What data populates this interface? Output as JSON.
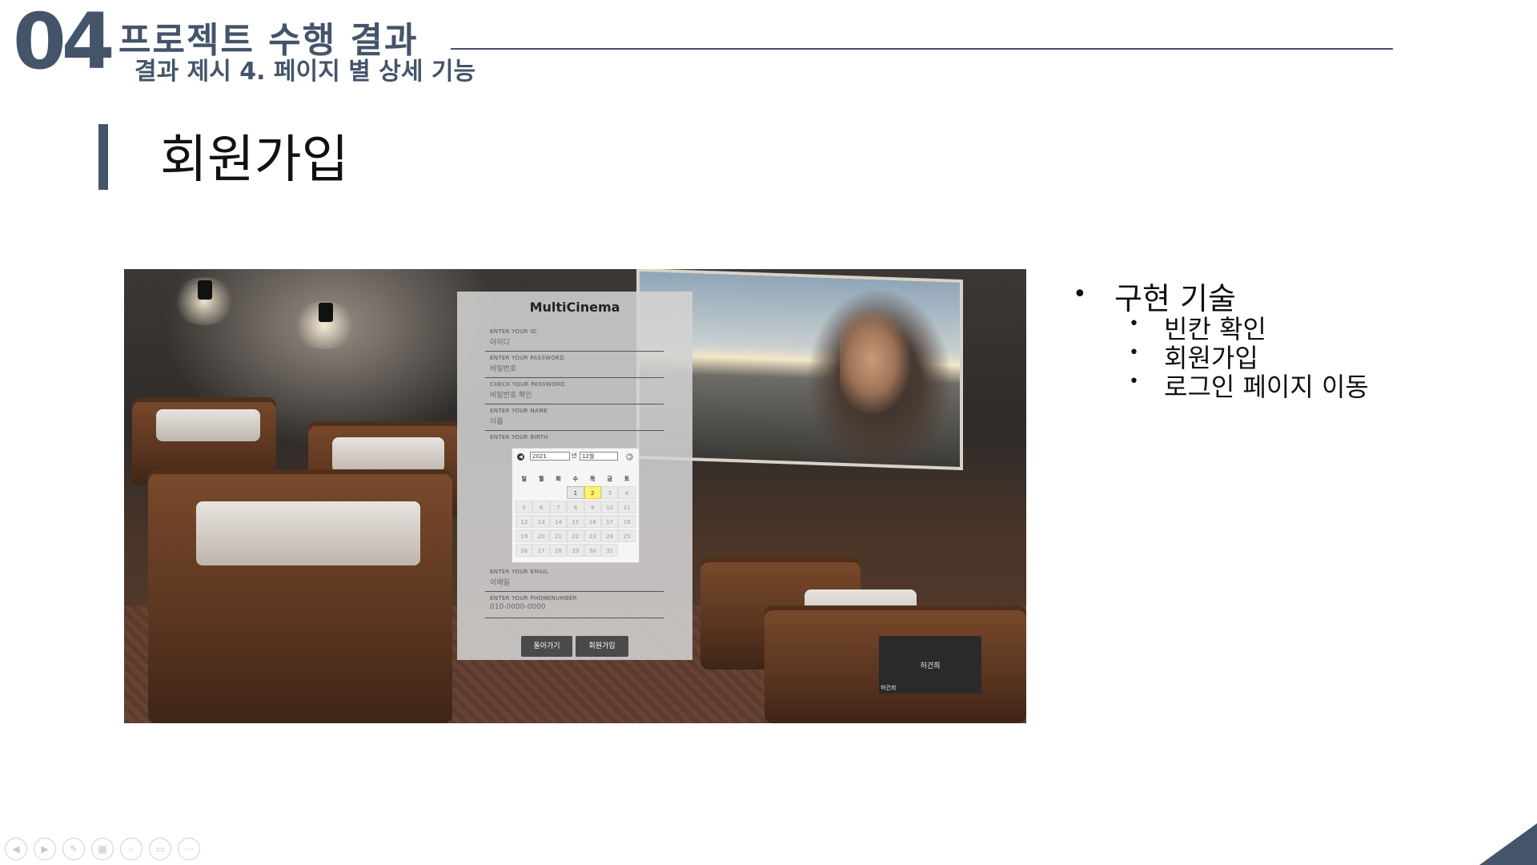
{
  "header": {
    "section_number": "04",
    "section_title": "프로젝트 수행 결과",
    "section_subtitle": "결과 제시 4. 페이지 별 상세 기능"
  },
  "page_heading": "회원가입",
  "screenshot": {
    "form": {
      "title": "MultiCinema",
      "fields": [
        {
          "label": "ENTER YOUR ID",
          "placeholder": "아이디"
        },
        {
          "label": "ENTER YOUR PASSWORD",
          "placeholder": "비밀번호"
        },
        {
          "label": "CHECK YOUR PASSWORD",
          "placeholder": "비밀번호 확인"
        },
        {
          "label": "ENTER YOUR NAME",
          "placeholder": "이름"
        },
        {
          "label": "ENTER YOUR BIRTH",
          "placeholder": ""
        },
        {
          "label": "ENTER YOUR EMAIL",
          "placeholder": "이메일"
        },
        {
          "label": "ENTER YOUR PHONENUMBER",
          "placeholder": "010-0000-0000"
        }
      ],
      "calendar": {
        "year_select": "2021",
        "year_suffix": "년",
        "month_select": "12월",
        "weekdays": [
          "일",
          "월",
          "화",
          "수",
          "목",
          "금",
          "토"
        ],
        "today": "2"
      },
      "back_button": "돌아가기",
      "signup_button": "회원가입"
    },
    "name_box": {
      "name": "허건희",
      "caption": "허건희"
    }
  },
  "bullets": {
    "main": "구현 기술",
    "items": [
      "빈칸 확인",
      "회원가입",
      "로그인 페이지 이동"
    ]
  },
  "colors": {
    "accent": "#44546a",
    "today_highlight": "#fff46a"
  },
  "toolbar_icons": [
    "prev-icon",
    "next-icon",
    "pen-icon",
    "slides-icon",
    "zoom-icon",
    "subtitle-icon",
    "more-icon"
  ]
}
